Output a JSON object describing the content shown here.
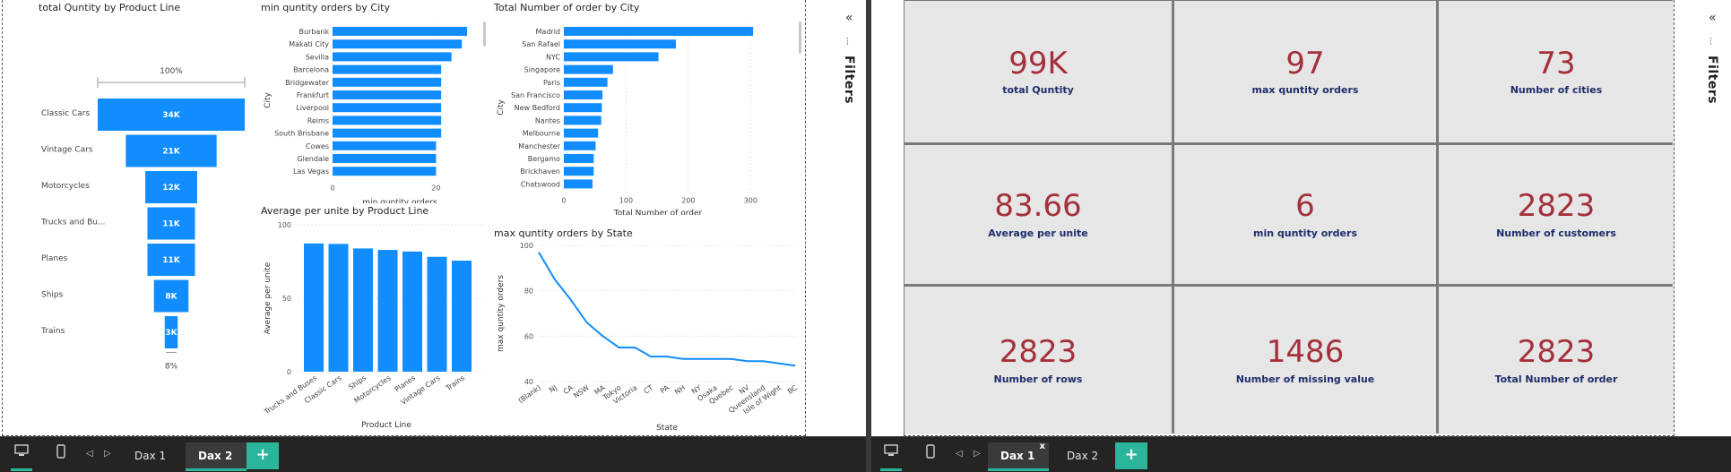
{
  "left": {
    "funnel": {
      "title": "total Quntity by Product Line",
      "top_pct": "100%",
      "bottom_pct": "8%",
      "stages": [
        {
          "label": "Classic Cars",
          "value_label": "34K",
          "value": 34000
        },
        {
          "label": "Vintage Cars",
          "value_label": "21K",
          "value": 21000
        },
        {
          "label": "Motorcycles",
          "value_label": "12K",
          "value": 12000
        },
        {
          "label": "Trucks and Bu...",
          "value_label": "11K",
          "value": 11000
        },
        {
          "label": "Planes",
          "value_label": "11K",
          "value": 11000
        },
        {
          "label": "Ships",
          "value_label": "8K",
          "value": 8000
        },
        {
          "label": "Trains",
          "value_label": "3K",
          "value": 3000
        }
      ]
    },
    "min_city": {
      "title": "min quntity orders by City",
      "ylabel": "City",
      "xlabel": "min quntity orders",
      "xticks": [
        "0",
        "20"
      ],
      "cities": [
        "Burbank",
        "Makati City",
        "Sevilla",
        "Barcelona",
        "Bridgewater",
        "Frankfurt",
        "Liverpool",
        "Reims",
        "South Brisbane",
        "Cowes",
        "Glendale",
        "Las Vegas"
      ],
      "values": [
        26,
        25,
        23,
        21,
        21,
        21,
        21,
        21,
        21,
        20,
        20,
        20
      ],
      "xmax": 26
    },
    "total_city": {
      "title": "Total Number of order by City",
      "ylabel": "City",
      "xlabel": "Total Number of order",
      "xticks": [
        "0",
        "100",
        "200",
        "300"
      ],
      "cities": [
        "Madrid",
        "San Rafael",
        "NYC",
        "Singapore",
        "Paris",
        "San Francisco",
        "New Bedford",
        "Nantes",
        "Melbourne",
        "Manchester",
        "Bergamo",
        "Brickhaven",
        "Chatswood"
      ],
      "values": [
        304,
        180,
        152,
        79,
        70,
        62,
        61,
        60,
        55,
        51,
        48,
        48,
        46
      ],
      "xmax": 360
    },
    "avg_product": {
      "title": "Average per unite by Product Line",
      "ylabel": "Average per unite",
      "xlabel": "Product Line",
      "yticks": [
        "0",
        "50",
        "100"
      ],
      "categories": [
        "Trucks and Buses",
        "Classic Cars",
        "Ships",
        "Motorcycles",
        "Planes",
        "Vintage Cars",
        "Trains"
      ],
      "values": [
        87.3,
        87.0,
        83.9,
        82.9,
        81.8,
        78.2,
        75.6
      ],
      "ymax": 100
    },
    "max_state": {
      "title": "max quntity orders by State",
      "ylabel": "max quntity orders",
      "xlabel": "State",
      "yticks": [
        "40",
        "60",
        "80",
        "100"
      ],
      "categories": [
        "(Blank)",
        "NJ",
        "CA",
        "NSW",
        "MA",
        "Tokyo",
        "Victoria",
        "CT",
        "PA",
        "NH",
        "NY",
        "Osaka",
        "Quebec",
        "NV",
        "Queensland",
        "Isle of Wight",
        "BC"
      ],
      "values": [
        97,
        85,
        76,
        66,
        60,
        55,
        55,
        51,
        51,
        50,
        50,
        50,
        50,
        49,
        49,
        48,
        47
      ],
      "ymin": 40,
      "ymax": 100
    },
    "filters_label": "Filters",
    "tabs": [
      "Dax 1",
      "Dax 2"
    ],
    "active_tab": "Dax 2"
  },
  "right": {
    "cards": [
      {
        "value": "99K",
        "label": "total Quntity"
      },
      {
        "value": "97",
        "label": "max quntity orders"
      },
      {
        "value": "73",
        "label": "Number of cities"
      },
      {
        "value": "83.66",
        "label": "Average per unite"
      },
      {
        "value": "6",
        "label": "min quntity orders"
      },
      {
        "value": "2823",
        "label": "Number of customers"
      },
      {
        "value": "2823",
        "label": "Number of rows"
      },
      {
        "value": "1486",
        "label": "Number of missing value"
      },
      {
        "value": "2823",
        "label": "Total Number of order"
      }
    ],
    "filters_label": "Filters",
    "tabs": [
      "Dax 1",
      "Dax 2"
    ],
    "active_tab": "Dax 1",
    "close_mark": "x"
  },
  "colors": {
    "bar": "#118dff",
    "card_value": "#a4303c",
    "card_label": "#1f2d6b",
    "accent": "#2bb59a"
  }
}
